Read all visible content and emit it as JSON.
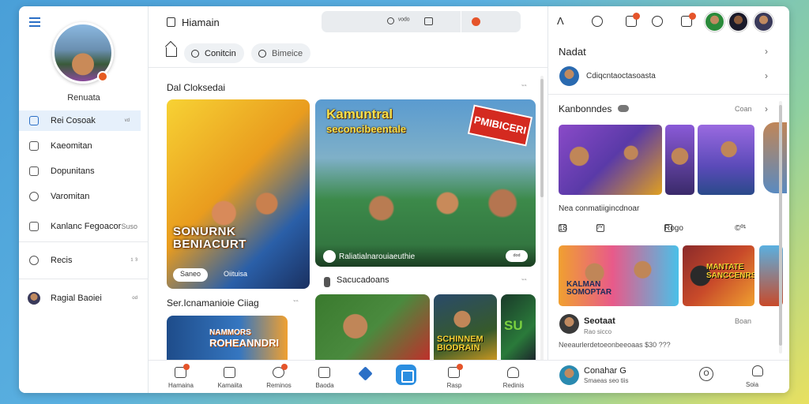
{
  "sidebar": {
    "profile_name": "Renuata",
    "items": [
      {
        "label": "Rei Cosoak",
        "aux": "ᵛᵈ"
      },
      {
        "label": "Kaeomitan",
        "aux": ""
      },
      {
        "label": "Dopunitans",
        "aux": ""
      },
      {
        "label": "Varomitan",
        "aux": ""
      },
      {
        "label": "Kanlanc Fegoacor",
        "aux": "Suso"
      },
      {
        "label": "Recis",
        "aux": "¹ ³"
      },
      {
        "label": "Ragial Baoiei",
        "aux": "ᵒᵈ"
      }
    ]
  },
  "header": {
    "title": "Hiamain",
    "search_text": "ᵛᵒᵈᵒ"
  },
  "tabs": {
    "tab1": "Conitcin",
    "tab2": "Bimeice"
  },
  "feed": {
    "section1_title": "Dal Cloksedai",
    "section1_more": "‶‶",
    "card1_title_line1": "SONURNK",
    "card1_title_line2": "BENIACURT",
    "card1_pill": "Saneo",
    "card1_tag": "Oiituisa",
    "card2_title_line1": "Kamuntral",
    "card2_title_line2": "seconcibeentale",
    "card2_banner": "PMIBICERI",
    "card2_caption": "Raliatialnarouiaeuthie",
    "card2_btn": "ᵈᵒᵈ",
    "sub_title": "Sacucadoans",
    "section2_title": "Ser.Icnamanioie Ciiag",
    "section2_more": "‶‶",
    "card3_title_line1": "NAMMORS",
    "card3_title_line2": "ROHEANNDRI",
    "card5_title_line1": "SCHINNEM",
    "card5_title_line2": "BIODRAIN",
    "card6_title": "SU"
  },
  "bottom_nav": [
    {
      "label": "Hamaina",
      "badge": true
    },
    {
      "label": "Kamaiita",
      "badge": false
    },
    {
      "label": "Reminos",
      "badge": true
    },
    {
      "label": "Baoda",
      "badge": false
    },
    {
      "label": "Rasp",
      "badge": true
    },
    {
      "label": "Redinis",
      "badge": false
    }
  ],
  "right": {
    "header": "Nadat",
    "row_text": "Cdiqcntaoctasoasta",
    "section_title": "Kanbonndes",
    "section_more": "Coan",
    "caption": "Nea conmatiigincdnoar",
    "stats": {
      "s1": "18",
      "s2": "ᵒⱽ",
      "s3": "Rogo",
      "s4": "©º¹"
    },
    "card1_title_line1": "KALMAN",
    "card1_title_line2": "SOMOPTAR",
    "card2_title_line1": "MANTATE",
    "card2_title_line2": "SANCCENRS",
    "post_name": "Seotaat",
    "post_sub": "Rao sicco",
    "post_more": "Boan",
    "post_text": "Neeaurlerdetoeonbeeoaas $30 ???",
    "foot_name": "Conahar G",
    "foot_sub": "Smaeas seo tiis",
    "foot_btn": "O",
    "foot_user": "Soia"
  },
  "colors": {
    "accent": "#2b6fc6",
    "badge": "#e5542a",
    "active_bg": "#e6f0fb"
  }
}
